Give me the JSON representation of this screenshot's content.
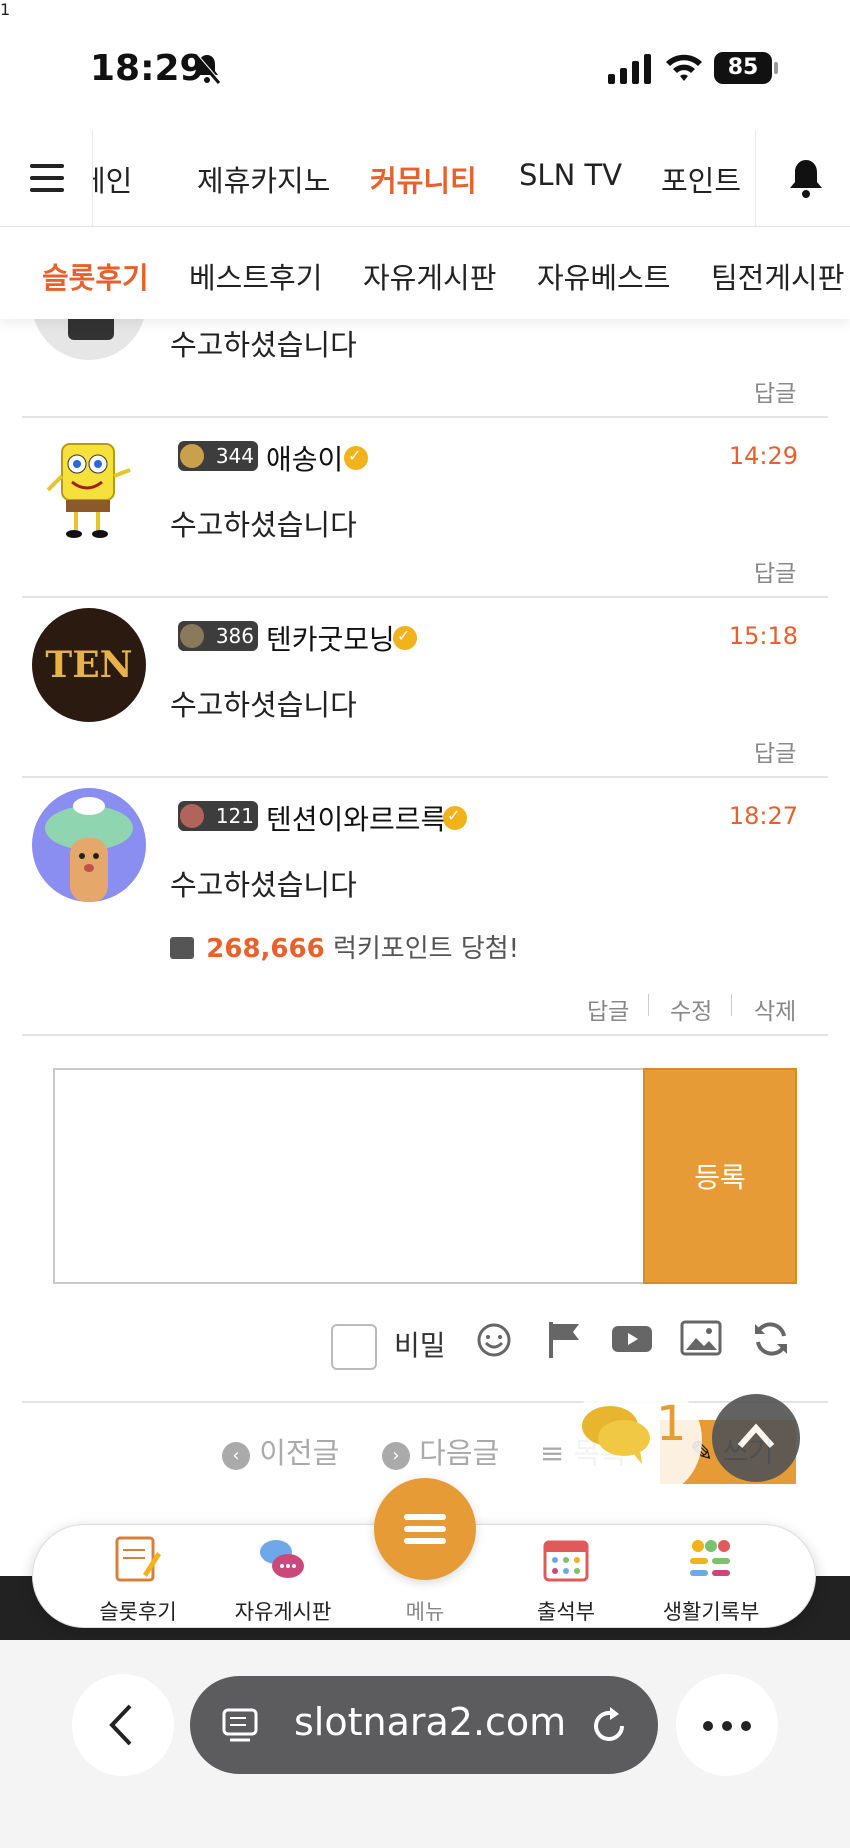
{
  "status_bar": {
    "time": "18:29",
    "battery": "85"
  },
  "top_nav": {
    "items": [
      "게인",
      "제휴카지노",
      "커뮤니티",
      "SLN TV",
      "포인트"
    ],
    "active_index": 2,
    "notification_count": "1"
  },
  "sub_nav": {
    "items": [
      "슬롯후기",
      "베스트후기",
      "자유게시판",
      "자유베스트",
      "팀전게시판"
    ],
    "active_index": 0
  },
  "comments": [
    {
      "text": "수고하셨습니다",
      "reply": "답글"
    },
    {
      "level": "344",
      "nickname": "애송이",
      "time": "14:29",
      "text": "수고하셨습니다",
      "reply": "답글"
    },
    {
      "level": "386",
      "nickname": "텐카굿모닝",
      "time": "15:18",
      "text": "수고하셧습니다",
      "reply": "답글"
    },
    {
      "level": "121",
      "nickname": "텐션이와르르륵",
      "time": "18:27",
      "text": "수고하셨습니다",
      "lucky_amount": "268,666",
      "lucky_text": "럭키포인트 당첨!",
      "reply": "답글",
      "edit": "수정",
      "delete": "삭제"
    }
  ],
  "editor": {
    "submit_label": "등록",
    "secret_label": "비밀",
    "tools": [
      "emoji-icon",
      "flag-icon",
      "youtube-icon",
      "image-icon",
      "refresh-icon"
    ]
  },
  "post_nav": {
    "prev": "이전글",
    "next": "다음글",
    "list": "목록",
    "write": "쓰기",
    "chat_count": "1"
  },
  "bottom_menu": {
    "items": [
      "슬롯후기",
      "자유게시판",
      "메뉴",
      "출석부",
      "생활기록부"
    ]
  },
  "browser": {
    "url": "slotnara2.com"
  },
  "colors": {
    "accent": "#e8602c",
    "button": "#e79b36"
  }
}
